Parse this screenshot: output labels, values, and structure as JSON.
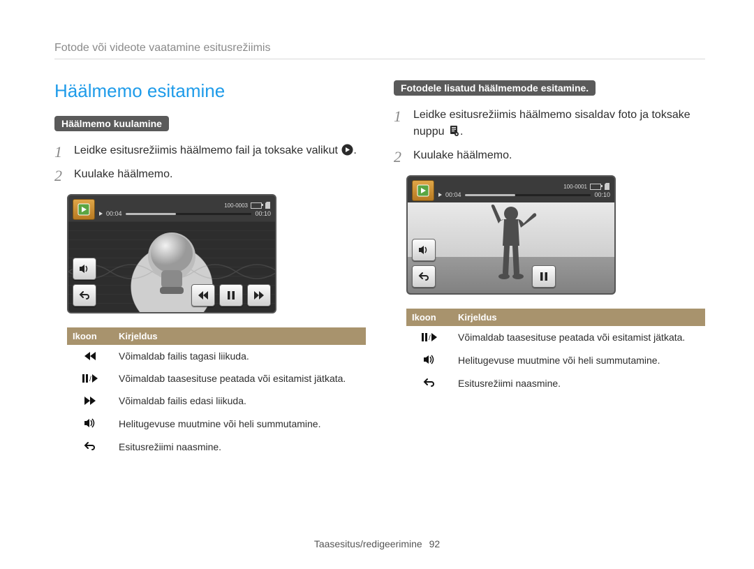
{
  "breadcrumb": "Fotode või videote vaatamine esitusrežiimis",
  "section_title": "Häälmemo esitamine",
  "left": {
    "pill": "Häälmemo kuulamine",
    "steps": [
      "Leidke esitusrežiimis häälmemo fail ja toksake valikut ",
      "Kuulake häälmemo."
    ],
    "device": {
      "file_id": "100-0003",
      "elapsed": "00:04",
      "total": "00:10"
    },
    "table": {
      "head": [
        "Ikoon",
        "Kirjeldus"
      ],
      "rows": [
        {
          "icon": "rewind",
          "text": "Võimaldab failis tagasi liikuda."
        },
        {
          "icon": "pause-play",
          "text": "Võimaldab taasesituse peatada või esitamist jätkata."
        },
        {
          "icon": "fast-forward",
          "text": "Võimaldab failis edasi liikuda."
        },
        {
          "icon": "volume",
          "text": "Helitugevuse muutmine või heli summutamine."
        },
        {
          "icon": "back",
          "text": "Esitusrežiimi naasmine."
        }
      ]
    }
  },
  "right": {
    "pill": "Fotodele lisatud häälmemode esitamine.",
    "steps": [
      "Leidke esitusrežiimis häälmemo sisaldav foto ja toksake nuppu ",
      "Kuulake häälmemo."
    ],
    "device": {
      "file_id": "100-0001",
      "elapsed": "00:04",
      "total": "00:10"
    },
    "table": {
      "head": [
        "Ikoon",
        "Kirjeldus"
      ],
      "rows": [
        {
          "icon": "pause-play",
          "text": "Võimaldab taasesituse peatada või esitamist jätkata."
        },
        {
          "icon": "volume",
          "text": "Helitugevuse muutmine või heli summutamine."
        },
        {
          "icon": "back",
          "text": "Esitusrežiimi naasmine."
        }
      ]
    }
  },
  "footer": {
    "text": "Taasesitus/redigeerimine",
    "page": "92"
  }
}
